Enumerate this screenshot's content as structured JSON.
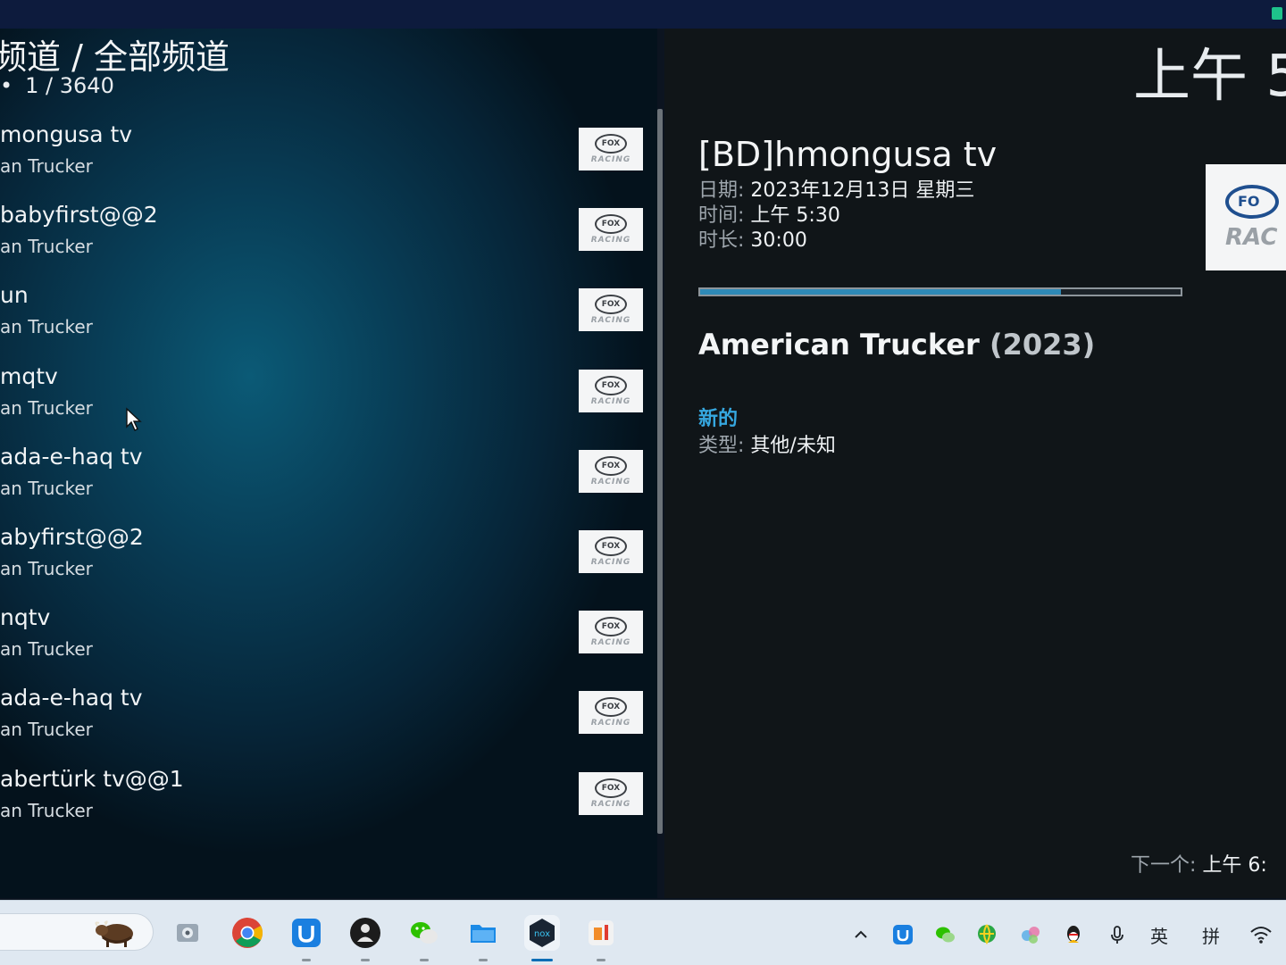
{
  "header": {
    "title": "频道 / 全部频道",
    "count": "1 / 3640",
    "bullet": "•"
  },
  "channels": [
    {
      "name": "mongusa tv",
      "program": "an Trucker"
    },
    {
      "name": "babyfirst@@2",
      "program": "an Trucker"
    },
    {
      "name": "un",
      "program": "an Trucker"
    },
    {
      "name": "mqtv",
      "program": "an Trucker"
    },
    {
      "name": "ada-e-haq tv",
      "program": "an Trucker"
    },
    {
      "name": "abyfirst@@2",
      "program": "an Trucker"
    },
    {
      "name": "nqtv",
      "program": "an Trucker"
    },
    {
      "name": "ada-e-haq tv",
      "program": "an Trucker"
    },
    {
      "name": "abertürk tv@@1",
      "program": "an Trucker"
    }
  ],
  "logo": {
    "oval": "FOX",
    "word": "RACING",
    "big_oval": "FO",
    "big_word": "RAC"
  },
  "clock": "上午 5",
  "detail": {
    "title": "[BD]hmongusa tv",
    "date_label": "日期:",
    "date_value": "2023年12月13日 星期三",
    "time_label": "时间:",
    "time_value": "上午 5:30",
    "duration_label": "时长:",
    "duration_value": "30:00",
    "progress_pct": 75,
    "program_title": "American Trucker",
    "program_year": "(2023)",
    "new_badge": "新的",
    "genre_label": "类型:",
    "genre_value": "其他/未知",
    "next_label": "下一个:",
    "next_value": "上午 6:"
  },
  "taskbar": {
    "apps": [
      "tools-icon",
      "chrome-icon",
      "shield-app-icon",
      "media-player-icon",
      "wechat-icon",
      "file-explorer-icon",
      "nox-icon",
      "office-icon"
    ],
    "tray": {
      "lang": "英",
      "ime": "拼"
    },
    "accent": "#0c6db5"
  }
}
